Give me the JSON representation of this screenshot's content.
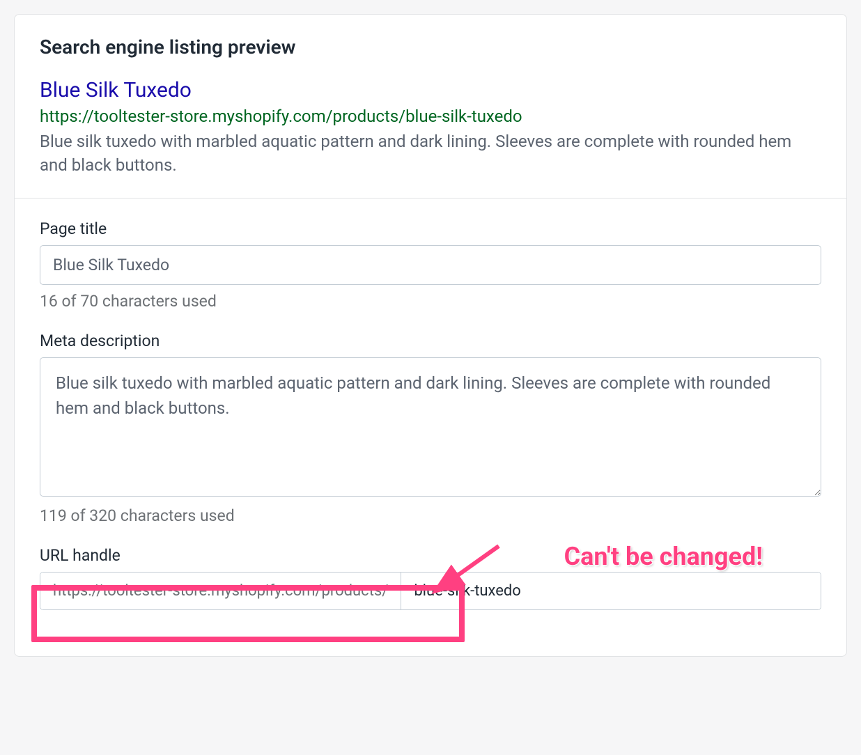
{
  "preview": {
    "heading": "Search engine listing preview",
    "title": "Blue Silk Tuxedo",
    "url": "https://tooltester-store.myshopify.com/products/blue-silk-tuxedo",
    "description": "Blue silk tuxedo with marbled aquatic pattern and dark lining. Sleeves are complete with rounded hem and black buttons."
  },
  "form": {
    "page_title": {
      "label": "Page title",
      "value": "Blue Silk Tuxedo",
      "helper": "16 of 70 characters used"
    },
    "meta_description": {
      "label": "Meta description",
      "value": "Blue silk tuxedo with marbled aquatic pattern and dark lining. Sleeves are complete with rounded hem and black buttons.",
      "helper": "119 of 320 characters used"
    },
    "url_handle": {
      "label": "URL handle",
      "prefix": "https://tooltester-store.myshopify.com/products/",
      "value": "blue-silk-tuxedo"
    }
  },
  "annotation": {
    "text": "Can't be changed!"
  }
}
